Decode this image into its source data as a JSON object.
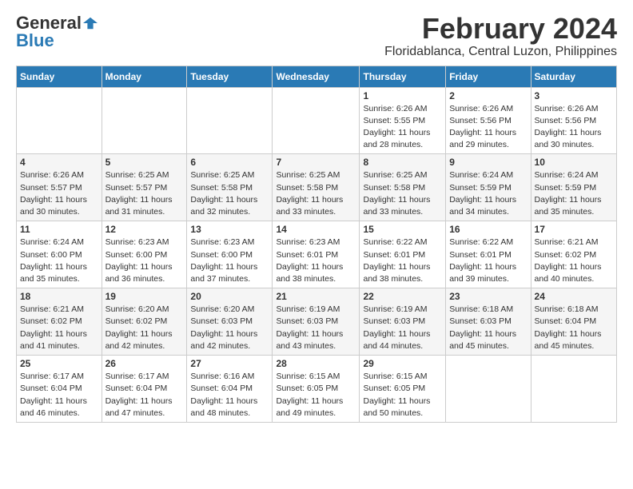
{
  "logo": {
    "general": "General",
    "blue": "Blue"
  },
  "title": "February 2024",
  "location": "Floridablanca, Central Luzon, Philippines",
  "days_of_week": [
    "Sunday",
    "Monday",
    "Tuesday",
    "Wednesday",
    "Thursday",
    "Friday",
    "Saturday"
  ],
  "weeks": [
    [
      {
        "day": "",
        "info": ""
      },
      {
        "day": "",
        "info": ""
      },
      {
        "day": "",
        "info": ""
      },
      {
        "day": "",
        "info": ""
      },
      {
        "day": "1",
        "info": "Sunrise: 6:26 AM\nSunset: 5:55 PM\nDaylight: 11 hours and 28 minutes."
      },
      {
        "day": "2",
        "info": "Sunrise: 6:26 AM\nSunset: 5:56 PM\nDaylight: 11 hours and 29 minutes."
      },
      {
        "day": "3",
        "info": "Sunrise: 6:26 AM\nSunset: 5:56 PM\nDaylight: 11 hours and 30 minutes."
      }
    ],
    [
      {
        "day": "4",
        "info": "Sunrise: 6:26 AM\nSunset: 5:57 PM\nDaylight: 11 hours and 30 minutes."
      },
      {
        "day": "5",
        "info": "Sunrise: 6:25 AM\nSunset: 5:57 PM\nDaylight: 11 hours and 31 minutes."
      },
      {
        "day": "6",
        "info": "Sunrise: 6:25 AM\nSunset: 5:58 PM\nDaylight: 11 hours and 32 minutes."
      },
      {
        "day": "7",
        "info": "Sunrise: 6:25 AM\nSunset: 5:58 PM\nDaylight: 11 hours and 33 minutes."
      },
      {
        "day": "8",
        "info": "Sunrise: 6:25 AM\nSunset: 5:58 PM\nDaylight: 11 hours and 33 minutes."
      },
      {
        "day": "9",
        "info": "Sunrise: 6:24 AM\nSunset: 5:59 PM\nDaylight: 11 hours and 34 minutes."
      },
      {
        "day": "10",
        "info": "Sunrise: 6:24 AM\nSunset: 5:59 PM\nDaylight: 11 hours and 35 minutes."
      }
    ],
    [
      {
        "day": "11",
        "info": "Sunrise: 6:24 AM\nSunset: 6:00 PM\nDaylight: 11 hours and 35 minutes."
      },
      {
        "day": "12",
        "info": "Sunrise: 6:23 AM\nSunset: 6:00 PM\nDaylight: 11 hours and 36 minutes."
      },
      {
        "day": "13",
        "info": "Sunrise: 6:23 AM\nSunset: 6:00 PM\nDaylight: 11 hours and 37 minutes."
      },
      {
        "day": "14",
        "info": "Sunrise: 6:23 AM\nSunset: 6:01 PM\nDaylight: 11 hours and 38 minutes."
      },
      {
        "day": "15",
        "info": "Sunrise: 6:22 AM\nSunset: 6:01 PM\nDaylight: 11 hours and 38 minutes."
      },
      {
        "day": "16",
        "info": "Sunrise: 6:22 AM\nSunset: 6:01 PM\nDaylight: 11 hours and 39 minutes."
      },
      {
        "day": "17",
        "info": "Sunrise: 6:21 AM\nSunset: 6:02 PM\nDaylight: 11 hours and 40 minutes."
      }
    ],
    [
      {
        "day": "18",
        "info": "Sunrise: 6:21 AM\nSunset: 6:02 PM\nDaylight: 11 hours and 41 minutes."
      },
      {
        "day": "19",
        "info": "Sunrise: 6:20 AM\nSunset: 6:02 PM\nDaylight: 11 hours and 42 minutes."
      },
      {
        "day": "20",
        "info": "Sunrise: 6:20 AM\nSunset: 6:03 PM\nDaylight: 11 hours and 42 minutes."
      },
      {
        "day": "21",
        "info": "Sunrise: 6:19 AM\nSunset: 6:03 PM\nDaylight: 11 hours and 43 minutes."
      },
      {
        "day": "22",
        "info": "Sunrise: 6:19 AM\nSunset: 6:03 PM\nDaylight: 11 hours and 44 minutes."
      },
      {
        "day": "23",
        "info": "Sunrise: 6:18 AM\nSunset: 6:03 PM\nDaylight: 11 hours and 45 minutes."
      },
      {
        "day": "24",
        "info": "Sunrise: 6:18 AM\nSunset: 6:04 PM\nDaylight: 11 hours and 45 minutes."
      }
    ],
    [
      {
        "day": "25",
        "info": "Sunrise: 6:17 AM\nSunset: 6:04 PM\nDaylight: 11 hours and 46 minutes."
      },
      {
        "day": "26",
        "info": "Sunrise: 6:17 AM\nSunset: 6:04 PM\nDaylight: 11 hours and 47 minutes."
      },
      {
        "day": "27",
        "info": "Sunrise: 6:16 AM\nSunset: 6:04 PM\nDaylight: 11 hours and 48 minutes."
      },
      {
        "day": "28",
        "info": "Sunrise: 6:15 AM\nSunset: 6:05 PM\nDaylight: 11 hours and 49 minutes."
      },
      {
        "day": "29",
        "info": "Sunrise: 6:15 AM\nSunset: 6:05 PM\nDaylight: 11 hours and 50 minutes."
      },
      {
        "day": "",
        "info": ""
      },
      {
        "day": "",
        "info": ""
      }
    ]
  ]
}
